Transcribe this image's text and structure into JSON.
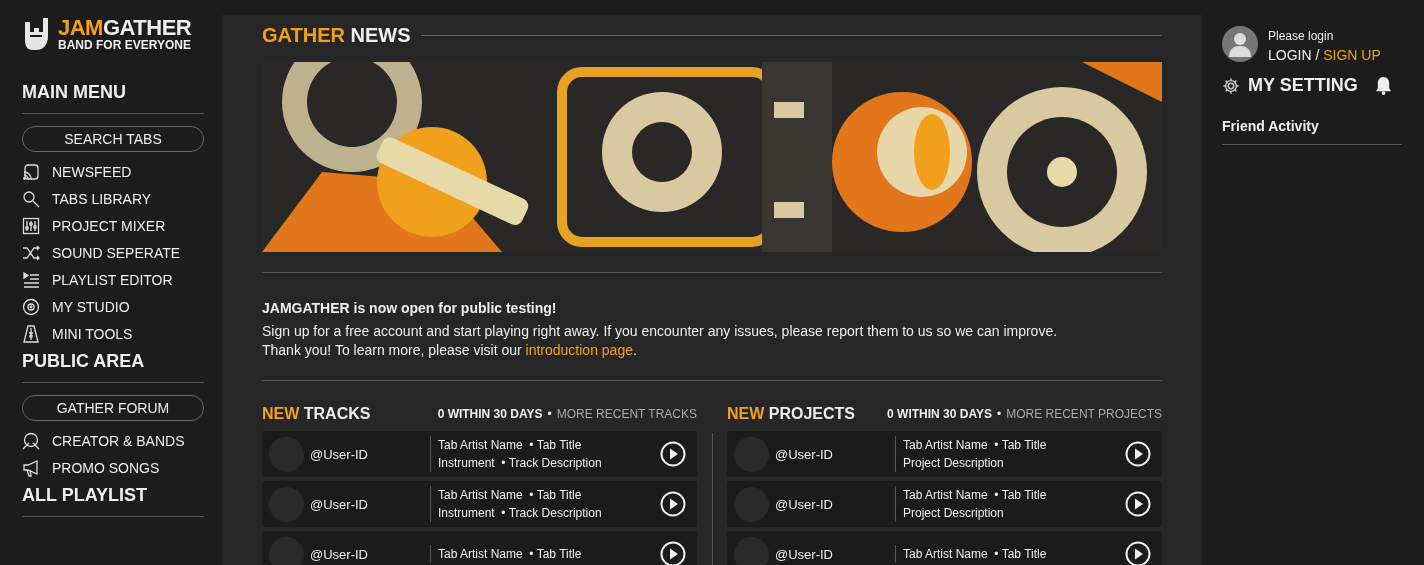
{
  "logo": {
    "brand_highlight": "JAM",
    "brand": "GATHER",
    "tagline": "BAND FOR EVERYONE"
  },
  "sidebar": {
    "sections": [
      {
        "title": "MAIN MENU",
        "button": "SEARCH TABS",
        "items": [
          {
            "label": "NEWSFEED"
          },
          {
            "label": "TABS LIBRARY"
          },
          {
            "label": "PROJECT MIXER"
          },
          {
            "label": "SOUND SEPERATE"
          },
          {
            "label": "PLAYLIST EDITOR"
          },
          {
            "label": "MY STUDIO"
          },
          {
            "label": "MINI TOOLS"
          }
        ]
      },
      {
        "title": "PUBLIC AREA",
        "button": "GATHER FORUM",
        "items": [
          {
            "label": "CREATOR & BANDS"
          },
          {
            "label": "PROMO SONGS"
          }
        ]
      },
      {
        "title": "ALL PLAYLIST"
      }
    ]
  },
  "news": {
    "title_highlight": "GATHER",
    "title": "NEWS",
    "notice": {
      "heading": "JAMGATHER is now open for public testing!",
      "line1": "Sign up for a free account and start playing right away. If you encounter any issues, please report them to us so we can improve.",
      "line2": "Thank you! To learn more, please visit our",
      "link": "introduction page",
      "line2_end": "."
    }
  },
  "lists": [
    {
      "title_highlight": "NEW",
      "title": "TRACKS",
      "count": "0 WITHIN 30 DAYS",
      "sep": "•",
      "more": "MORE RECENT TRACKS",
      "rows": [
        {
          "user": "@User-ID",
          "line1": "Tab Artist Name  • Tab Title",
          "line2": "Instrument  • Track Description"
        },
        {
          "user": "@User-ID",
          "line1": "Tab Artist Name  • Tab Title",
          "line2": "Instrument  • Track Description"
        },
        {
          "user": "@User-ID",
          "line1": "Tab Artist Name  • Tab Title"
        }
      ]
    },
    {
      "title_highlight": "NEW",
      "title": "PROJECTS",
      "count": "0 WITHIN 30 DAYS",
      "sep": "•",
      "more": "MORE RECENT PROJECTS",
      "rows": [
        {
          "user": "@User-ID",
          "line1": "Tab Artist Name  • Tab Title",
          "line2": "Project Description"
        },
        {
          "user": "@User-ID",
          "line1": "Tab Artist Name  • Tab Title",
          "line2": "Project Description"
        },
        {
          "user": "@User-ID",
          "line1": "Tab Artist Name  • Tab Title"
        }
      ]
    }
  ],
  "account": {
    "prompt": "Please login",
    "login": "LOGIN",
    "sep": "/",
    "signup": "SIGN UP",
    "settings": "MY SETTING",
    "friends": "Friend Activity"
  }
}
